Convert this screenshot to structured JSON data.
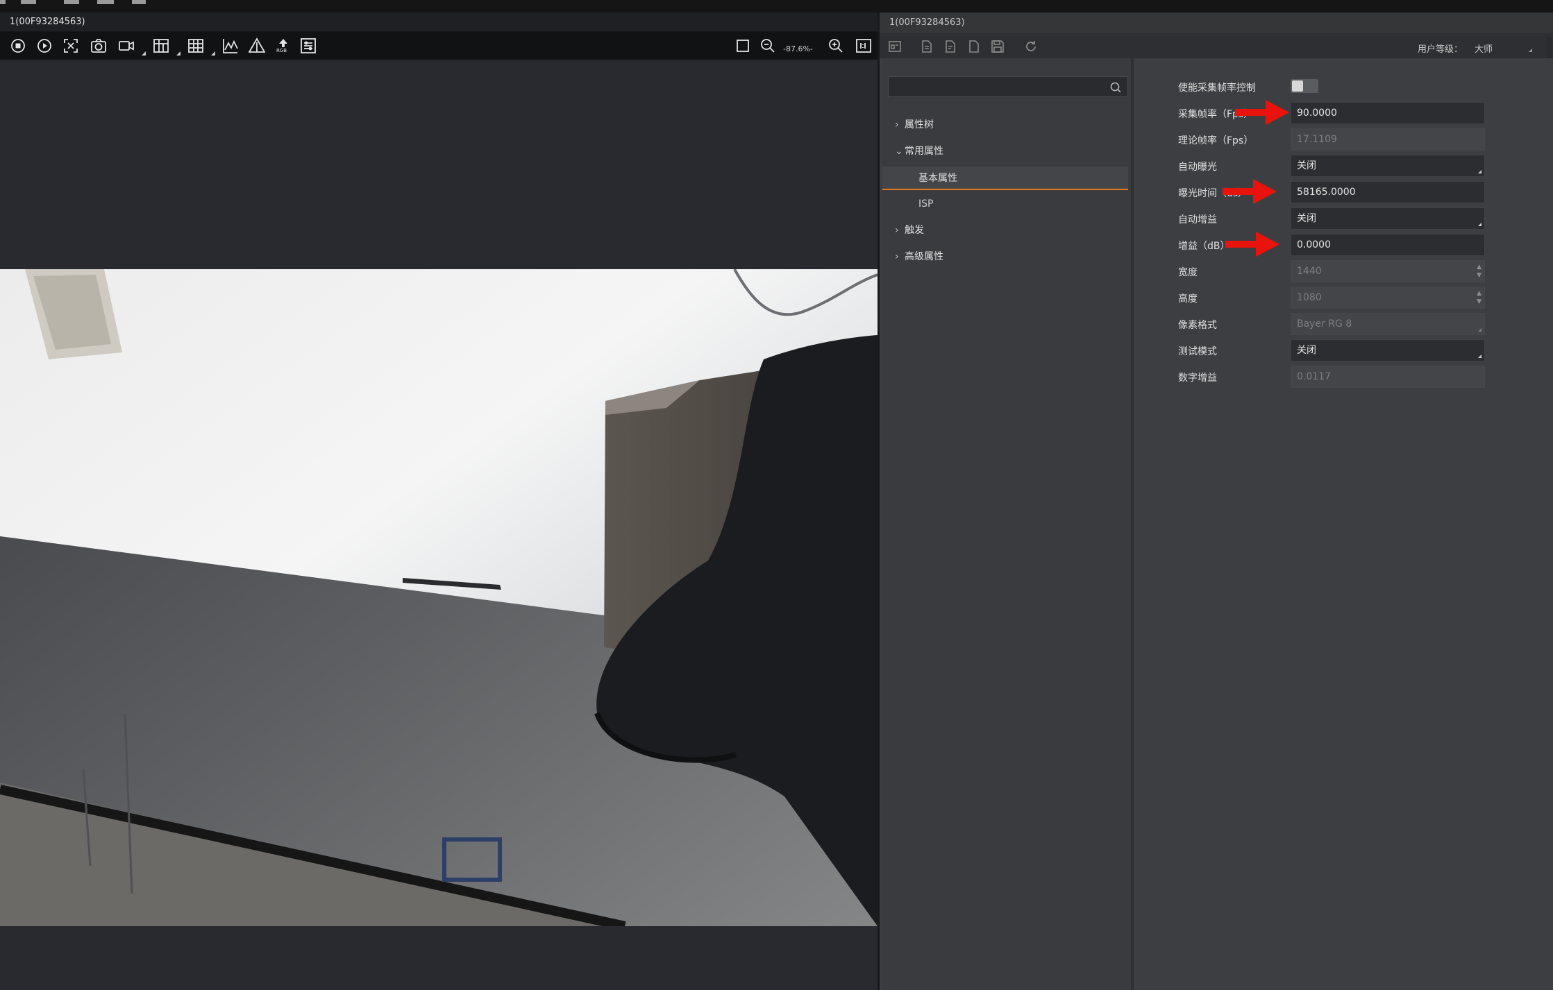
{
  "left_panel": {
    "title": "1(00F93284563)",
    "toolbar": {
      "icons": [
        "stop-icon",
        "play-icon",
        "fit-icon",
        "snapshot-icon",
        "record-icon",
        "grid-icon",
        "table-grid-icon",
        "histogram-icon",
        "warning-icon",
        "rgb-icon",
        "settings-icon"
      ],
      "rgb_label": "RGB",
      "zoom_text": "-87.6%-"
    }
  },
  "right_panel": {
    "title": "1(00F93284563)",
    "user_level_label": "用户等级：",
    "user_level_value": "大师",
    "tree": {
      "search_placeholder": "",
      "items": [
        {
          "label": "属性树",
          "expanded": false
        },
        {
          "label": "常用属性",
          "expanded": true
        },
        {
          "label": "基本属性",
          "selected": true
        },
        {
          "label": "ISP"
        },
        {
          "label": "触发",
          "expanded": false
        },
        {
          "label": "高级属性",
          "expanded": false
        }
      ]
    },
    "properties": [
      {
        "label": "使能采集帧率控制",
        "type": "toggle",
        "value": false
      },
      {
        "label": "采集帧率（Fps）",
        "value": "90.0000",
        "highlighted": true
      },
      {
        "label": "理论帧率（Fps）",
        "value": "17.1109",
        "disabled": true
      },
      {
        "label": "自动曝光",
        "value": "关闭"
      },
      {
        "label": "曝光时间（us）",
        "value": "58165.0000",
        "highlighted": true
      },
      {
        "label": "自动增益",
        "value": "关闭"
      },
      {
        "label": "增益（dB）",
        "value": "0.0000",
        "highlighted": true
      },
      {
        "label": "宽度",
        "value": "1440",
        "disabled": true
      },
      {
        "label": "高度",
        "value": "1080",
        "disabled": true
      },
      {
        "label": "像素格式",
        "value": "Bayer RG 8",
        "disabled": true
      },
      {
        "label": "测试模式",
        "value": "关闭"
      },
      {
        "label": "数字增益",
        "value": "0.0117",
        "disabled": true
      }
    ]
  },
  "colors": {
    "accent": "#e2761b",
    "annotation_arrow": "#e8130c"
  }
}
